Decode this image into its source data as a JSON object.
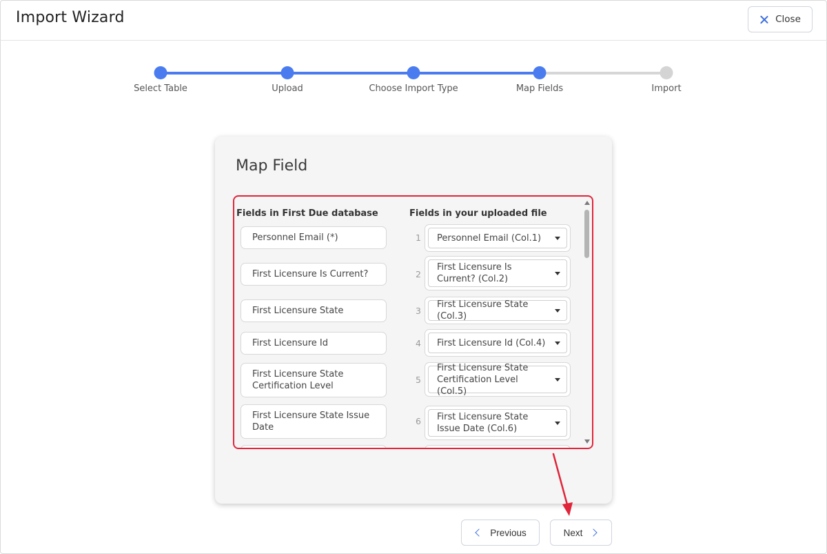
{
  "header": {
    "title": "Import Wizard",
    "close_label": "Close"
  },
  "stepper": {
    "steps": [
      {
        "label": "Select Table",
        "state": "done"
      },
      {
        "label": "Upload",
        "state": "done"
      },
      {
        "label": "Choose Import Type",
        "state": "done"
      },
      {
        "label": "Map Fields",
        "state": "current"
      },
      {
        "label": "Import",
        "state": "todo"
      }
    ]
  },
  "card": {
    "title": "Map Field",
    "left_header": "Fields in First Due database",
    "right_header": "Fields in your uploaded file",
    "rows": [
      {
        "db_field": "Personnel Email (*)",
        "num": "1",
        "file_field": "Personnel Email (Col.1)"
      },
      {
        "db_field": "First Licensure Is Current?",
        "num": "2",
        "file_field": "First Licensure Is Current? (Col.2)"
      },
      {
        "db_field": "First Licensure State",
        "num": "3",
        "file_field": "First Licensure State (Col.3)"
      },
      {
        "db_field": "First Licensure Id",
        "num": "4",
        "file_field": "First Licensure Id (Col.4)"
      },
      {
        "db_field": "First Licensure State Certification Level",
        "num": "5",
        "file_field": "First Licensure State Certification Level (Col.5)"
      },
      {
        "db_field": "First Licensure State Issue Date",
        "num": "6",
        "file_field": "First Licensure State Issue Date (Col.6)"
      }
    ]
  },
  "footer": {
    "previous_label": "Previous",
    "next_label": "Next"
  },
  "colors": {
    "accent": "#4a7cf0",
    "highlight": "#e0243a"
  }
}
